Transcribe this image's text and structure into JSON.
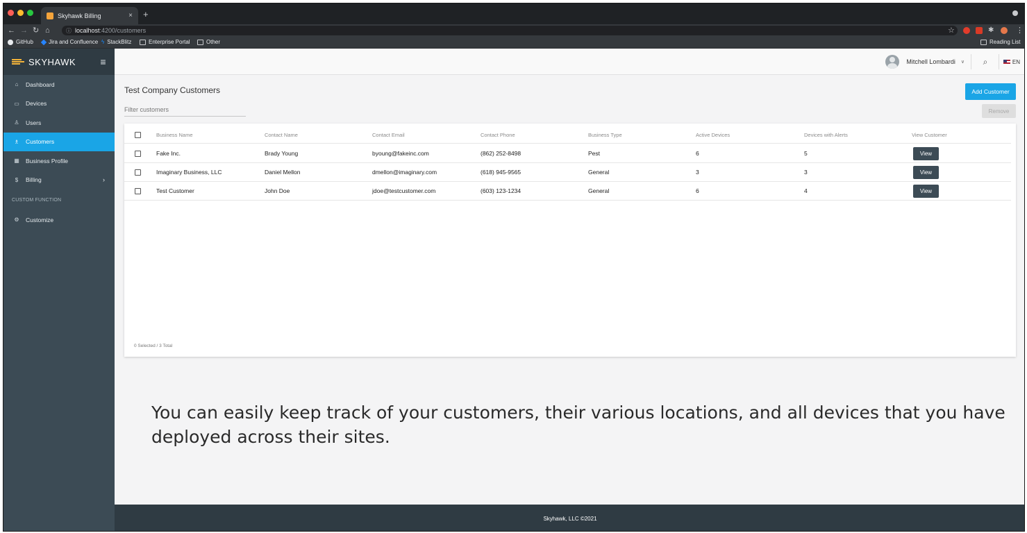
{
  "browser": {
    "tab_title": "Skyhawk Billing",
    "tab_close": "×",
    "new_tab": "+",
    "url_host": "localhost",
    "url_rest": ":4200/customers",
    "bookmarks": [
      "GitHub",
      "Jira and Confluence",
      "StackBlitz",
      "Enterprise Portal",
      "Other"
    ],
    "reading_list": "Reading List",
    "extensions": [
      {
        "name": "extension-shield-icon",
        "color": "#e23c2b"
      },
      {
        "name": "extension-menu-icon",
        "color": "#d93a26"
      },
      {
        "name": "puzzle-icon",
        "color": "#e8eaed"
      },
      {
        "name": "profile-avatar-icon",
        "color": "#e6784b"
      }
    ]
  },
  "sidebar": {
    "brand": "SKYHAWK",
    "items": [
      {
        "label": "Dashboard",
        "icon": "home-icon",
        "glyph": "⌂"
      },
      {
        "label": "Devices",
        "icon": "devices-icon",
        "glyph": "▭"
      },
      {
        "label": "Users",
        "icon": "user-icon",
        "glyph": "♙"
      },
      {
        "label": "Customers",
        "icon": "customers-icon",
        "glyph": "♗",
        "active": true
      },
      {
        "label": "Business Profile",
        "icon": "business-icon",
        "glyph": "▦"
      },
      {
        "label": "Billing",
        "icon": "dollar-icon",
        "glyph": "$",
        "chevron": "›"
      }
    ],
    "section_label": "CUSTOM FUNCTION",
    "custom_items": [
      {
        "label": "Customize",
        "icon": "gear-icon",
        "glyph": "⚙"
      }
    ]
  },
  "header": {
    "user_name": "Mitchell Lombardi",
    "user_caret": "∨",
    "language": "EN"
  },
  "main": {
    "title": "Test Company Customers",
    "add_button": "Add Customer",
    "filter_placeholder": "Filter customers",
    "remove_button": "Remove",
    "columns": [
      "Business Name",
      "Contact Name",
      "Contact Email",
      "Contact Phone",
      "Business Type",
      "Active Devices",
      "Devices with Alerts",
      "View Customer"
    ],
    "rows": [
      [
        "Fake Inc.",
        "Brady Young",
        "byoung@fakeinc.com",
        "(862) 252-8498",
        "Pest",
        "6",
        "5"
      ],
      [
        "Imaginary Business, LLC",
        "Daniel Mellon",
        "dmellon@imaginary.com",
        "(618) 945-9565",
        "General",
        "3",
        "3"
      ],
      [
        "Test Customer",
        "John Doe",
        "jdoe@testcustomer.com",
        "(603) 123-1234",
        "General",
        "6",
        "4"
      ]
    ],
    "view_label": "View",
    "selection_summary": "0 Selected / 3 Total"
  },
  "promo_text": "You can easily keep track of your customers, their various locations, and all devices that you have deployed across their sites.",
  "footer": "Skyhawk, LLC ©2021",
  "colors": {
    "accent": "#1aa5e6",
    "sidebar": "#3c4b55",
    "dark": "#2f3b43"
  }
}
